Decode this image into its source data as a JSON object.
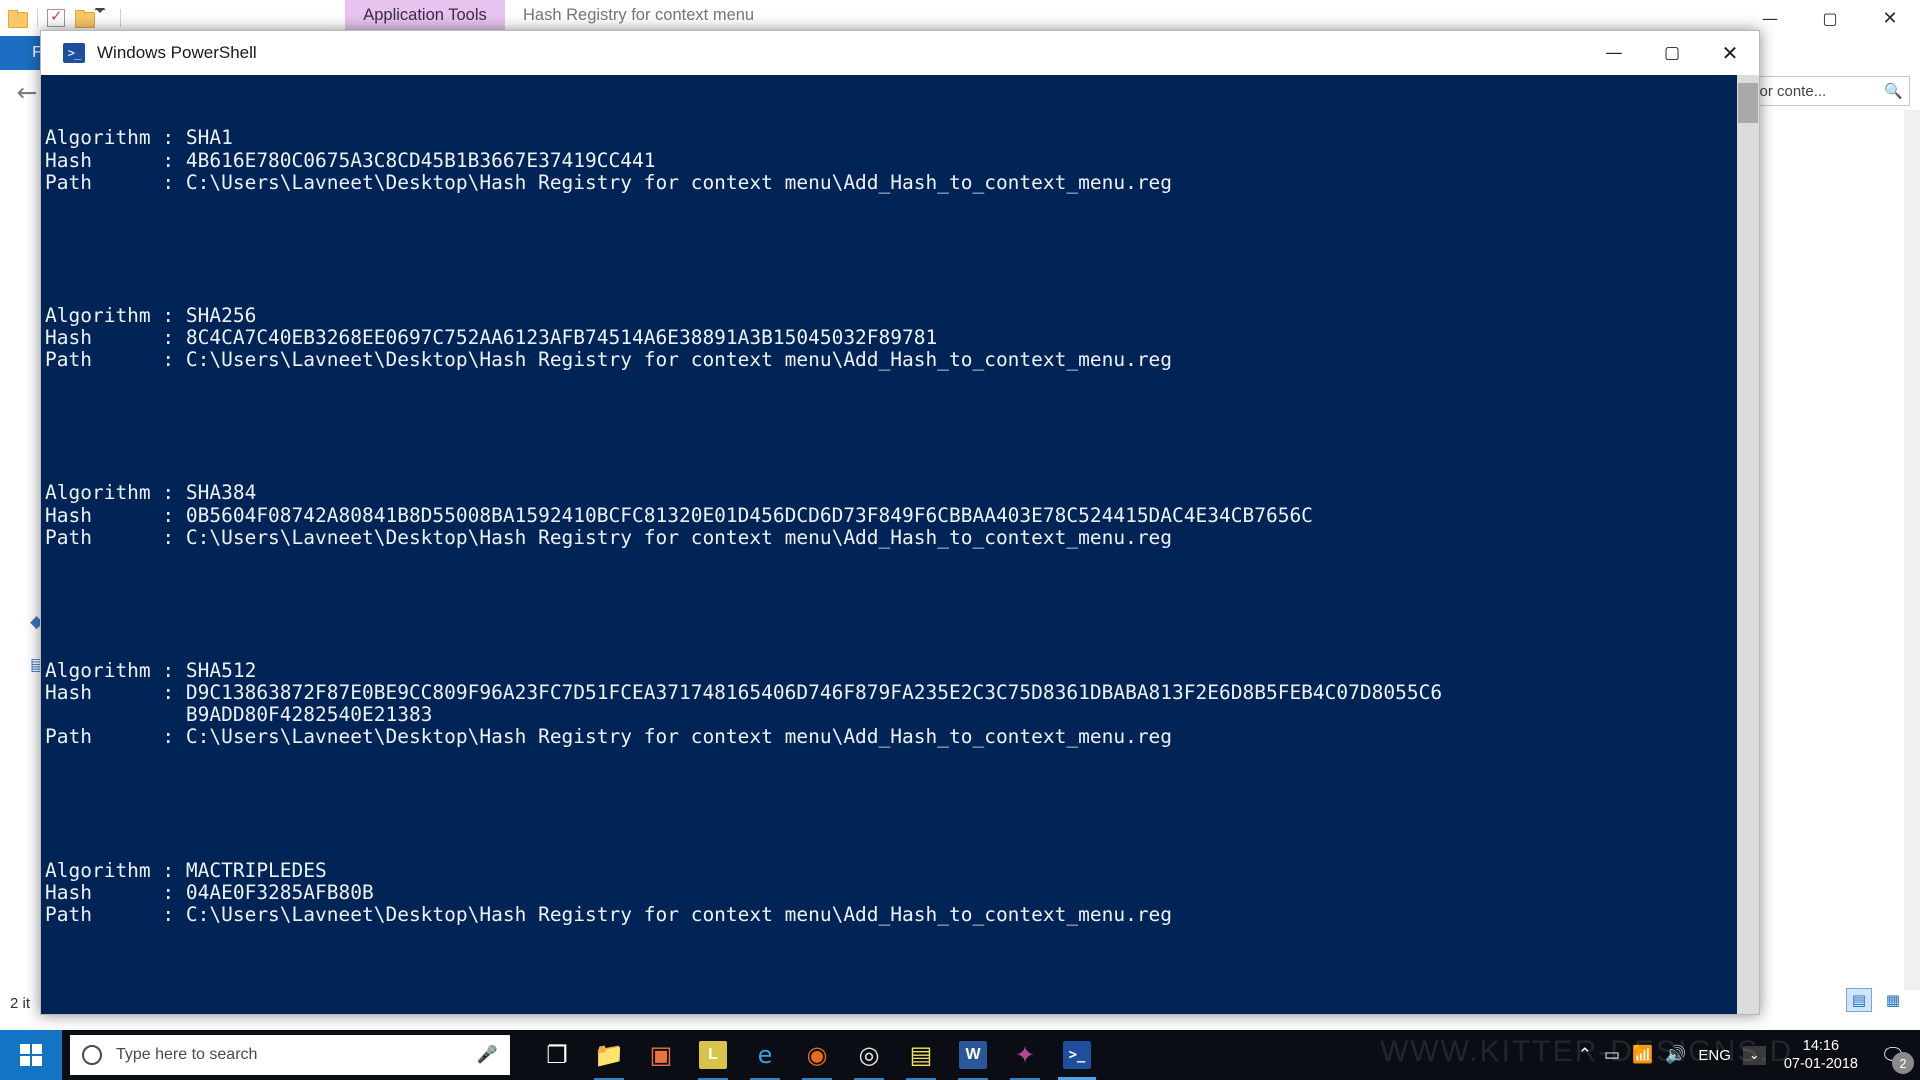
{
  "explorer": {
    "ribbon_context_tab": "Application Tools",
    "document_title": "Hash Registry for context menu",
    "file_tab": "File",
    "search_value": "stry for conte...",
    "status_text": "2 it",
    "window_controls": {
      "minimize": "—",
      "maximize": "▢",
      "close": "✕"
    },
    "help_label": "?",
    "chevron": "⌄",
    "back_arrow": "←",
    "search_icon": "🔍"
  },
  "powershell": {
    "title": "Windows PowerShell",
    "icon_text": ">_",
    "controls": {
      "minimize": "—",
      "maximize": "▢",
      "close": "✕"
    },
    "console_lines": [
      "",
      "",
      "Algorithm : SHA1",
      "Hash      : 4B616E780C0675A3C8CD45B1B3667E37419CC441",
      "Path      : C:\\Users\\Lavneet\\Desktop\\Hash Registry for context menu\\Add_Hash_to_context_menu.reg",
      "",
      "",
      "",
      "",
      "",
      "Algorithm : SHA256",
      "Hash      : 8C4CA7C40EB3268EE0697C752AA6123AFB74514A6E38891A3B15045032F89781",
      "Path      : C:\\Users\\Lavneet\\Desktop\\Hash Registry for context menu\\Add_Hash_to_context_menu.reg",
      "",
      "",
      "",
      "",
      "",
      "Algorithm : SHA384",
      "Hash      : 0B5604F08742A80841B8D55008BA1592410BCFC81320E01D456DCD6D73F849F6CBBAA403E78C524415DAC4E34CB7656C",
      "Path      : C:\\Users\\Lavneet\\Desktop\\Hash Registry for context menu\\Add_Hash_to_context_menu.reg",
      "",
      "",
      "",
      "",
      "",
      "Algorithm : SHA512",
      "Hash      : D9C13863872F87E0BE9CC809F96A23FC7D51FCEA371748165406D746F879FA235E2C3C75D8361DBABA813F2E6D8B5FEB4C07D8055C6",
      "            B9ADD80F4282540E21383",
      "Path      : C:\\Users\\Lavneet\\Desktop\\Hash Registry for context menu\\Add_Hash_to_context_menu.reg",
      "",
      "",
      "",
      "",
      "",
      "Algorithm : MACTRIPLEDES",
      "Hash      : 04AE0F3285AFB80B",
      "Path      : C:\\Users\\Lavneet\\Desktop\\Hash Registry for context menu\\Add_Hash_to_context_menu.reg"
    ]
  },
  "taskbar": {
    "search_placeholder": "Type here to search",
    "mic_icon": "🎤",
    "apps": [
      {
        "name": "task-view",
        "glyph": "❐",
        "color": "#ffffff",
        "running": false
      },
      {
        "name": "file-explorer",
        "glyph": "📁",
        "color": "#f5c152",
        "running": true
      },
      {
        "name": "microsoft-store",
        "glyph": "▣",
        "color": "#e8733f",
        "running": false
      },
      {
        "name": "lightshot",
        "glyph": "L",
        "color": "#d8c44a",
        "running": true
      },
      {
        "name": "microsoft-edge",
        "glyph": "e",
        "color": "#3aa0dd",
        "running": true
      },
      {
        "name": "firefox",
        "glyph": "◉",
        "color": "#e86a1f",
        "running": true
      },
      {
        "name": "google-chrome",
        "glyph": "◎",
        "color": "#e8e8e8",
        "running": true
      },
      {
        "name": "sticky-notes",
        "glyph": "▤",
        "color": "#f2e35c",
        "running": true
      },
      {
        "name": "microsoft-word",
        "glyph": "W",
        "color": "#2b579a",
        "running": true
      },
      {
        "name": "paint-net",
        "glyph": "✦",
        "color": "#b04a9c",
        "running": true
      },
      {
        "name": "windows-powershell",
        "glyph": ">_",
        "color": "#1f4e9c",
        "running": true,
        "active": true
      }
    ],
    "tray": {
      "show_hidden_icons": "⌃",
      "battery": "▭",
      "network": "📶",
      "volume": "🔊",
      "language": "ENG",
      "time": "14:16",
      "date": "07-01-2018",
      "notification_count": "2",
      "chevron": "⌄"
    },
    "watermark": "WWW.KITTER-DESIGNS.D"
  }
}
